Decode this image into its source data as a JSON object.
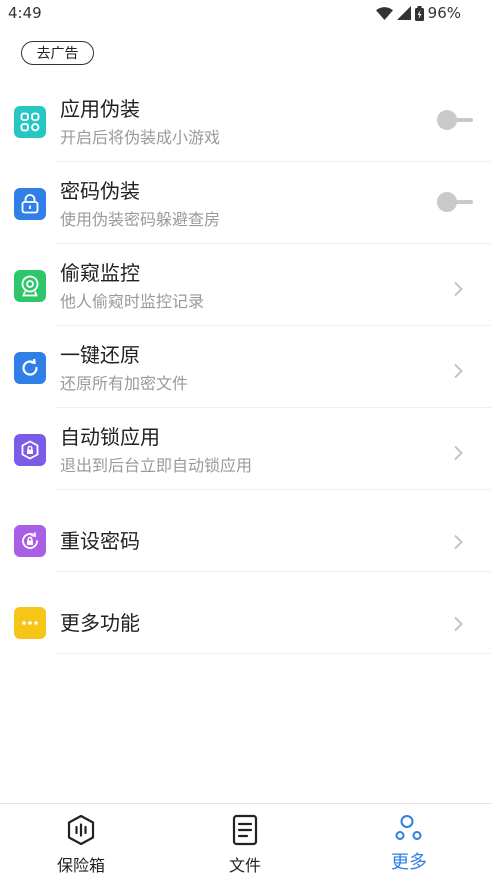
{
  "status_bar": {
    "time": "4:49",
    "battery": "96%",
    "icons": [
      "wifi-icon",
      "signal-icon",
      "battery-icon"
    ]
  },
  "ad_button": {
    "label": "去广告"
  },
  "menu": {
    "items": [
      {
        "title": "应用伪装",
        "subtitle": "开启后将伪装成小游戏",
        "icon": "apps-grid-icon",
        "icon_color": "#26c6c2",
        "control": "toggle",
        "enabled": false
      },
      {
        "title": "密码伪装",
        "subtitle": "使用伪装密码躲避查房",
        "icon": "lock-icon",
        "icon_color": "#2f7fe6",
        "control": "toggle",
        "enabled": false
      },
      {
        "title": "偷窥监控",
        "subtitle": "他人偷窥时监控记录",
        "icon": "webcam-icon",
        "icon_color": "#2dc66b",
        "control": "chevron"
      },
      {
        "title": "一键还原",
        "subtitle": "还原所有加密文件",
        "icon": "refresh-icon",
        "icon_color": "#2f7fe6",
        "control": "chevron"
      },
      {
        "title": "自动锁应用",
        "subtitle": "退出到后台立即自动锁应用",
        "icon": "shield-lock-icon",
        "icon_color": "#7b5ce6",
        "control": "chevron"
      },
      {
        "title": "重设密码",
        "icon": "reset-password-icon",
        "icon_color": "#a95ee6",
        "control": "chevron"
      },
      {
        "title": "更多功能",
        "icon": "more-dots-icon",
        "icon_color": "#f5c518",
        "control": "chevron"
      }
    ]
  },
  "bottom_nav": {
    "items": [
      {
        "label": "保险箱",
        "icon": "safe-box-icon",
        "active": false
      },
      {
        "label": "文件",
        "icon": "document-icon",
        "active": false
      },
      {
        "label": "更多",
        "icon": "more-nodes-icon",
        "active": true
      }
    ],
    "active_color": "#2f7fe6"
  }
}
